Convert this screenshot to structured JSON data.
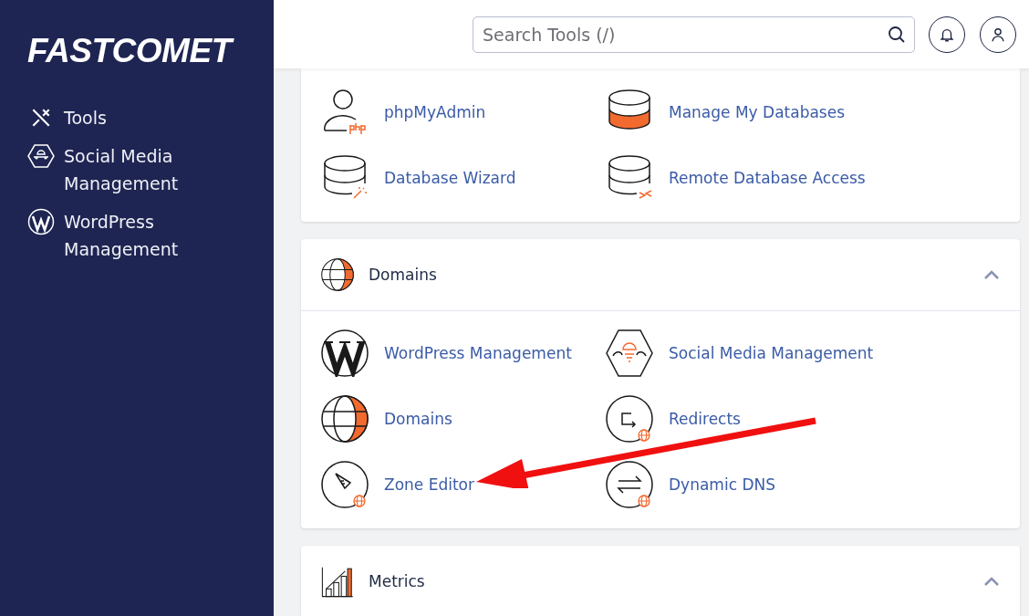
{
  "sidebar": {
    "logo": "FASTCOMET",
    "items": [
      {
        "label": "Tools"
      },
      {
        "label": "Social Media Management"
      },
      {
        "label": "WordPress Management"
      }
    ]
  },
  "header": {
    "search": {
      "placeholder": "Search Tools (/)"
    }
  },
  "sections": [
    {
      "items": [
        {
          "label": "phpMyAdmin"
        },
        {
          "label": "Manage My Databases"
        },
        {
          "label": "Database Wizard"
        },
        {
          "label": "Remote Database Access"
        }
      ]
    },
    {
      "title": "Domains",
      "expanded": true,
      "items": [
        {
          "label": "WordPress Management"
        },
        {
          "label": "Social Media Management"
        },
        {
          "label": "Domains"
        },
        {
          "label": "Redirects"
        },
        {
          "label": "Zone Editor"
        },
        {
          "label": "Dynamic DNS"
        }
      ]
    },
    {
      "title": "Metrics",
      "expanded": true
    }
  ]
}
